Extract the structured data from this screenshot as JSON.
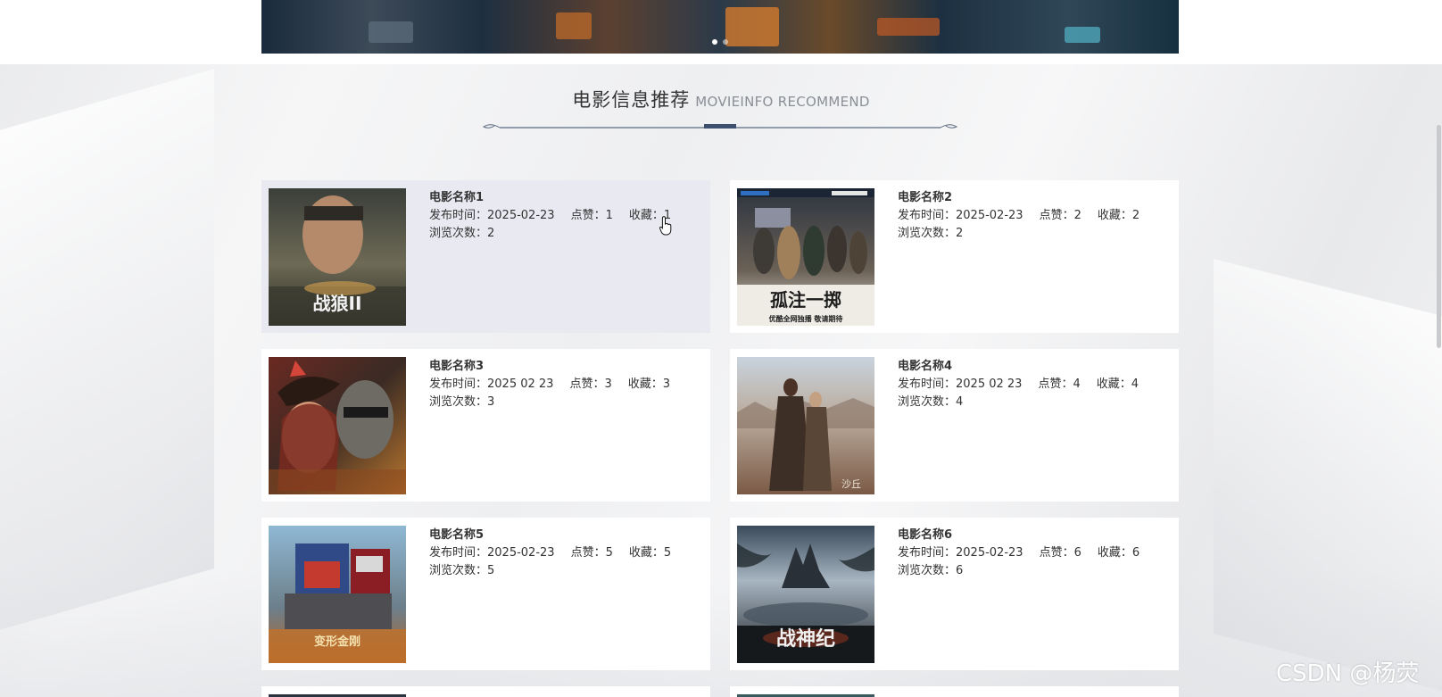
{
  "section": {
    "title": "电影信息推荐",
    "subtitle": "MOVIEINFO RECOMMEND"
  },
  "labels": {
    "release": "发布时间：",
    "likes": "点赞：",
    "favorites": "收藏：",
    "views": "浏览次数："
  },
  "movies": [
    {
      "name": "电影名称1",
      "release_date": "2025-02-23",
      "likes": "1",
      "favorites": "1",
      "views": "2",
      "poster_text": "战狼II"
    },
    {
      "name": "电影名称2",
      "release_date": "2025-02-23",
      "likes": "2",
      "favorites": "2",
      "views": "2",
      "poster_text": "孤注一掷",
      "poster_tagline": "优酷全网独播 敬请期待"
    },
    {
      "name": "电影名称3",
      "release_date": "2025 02 23",
      "likes": "3",
      "favorites": "3",
      "views": "3"
    },
    {
      "name": "电影名称4",
      "release_date": "2025 02 23",
      "likes": "4",
      "favorites": "4",
      "views": "4",
      "poster_text": "沙丘"
    },
    {
      "name": "电影名称5",
      "release_date": "2025-02-23",
      "likes": "5",
      "favorites": "5",
      "views": "5",
      "poster_text": "变形金刚"
    },
    {
      "name": "电影名称6",
      "release_date": "2025-02-23",
      "likes": "6",
      "favorites": "6",
      "views": "6",
      "poster_text": "战神纪"
    }
  ],
  "watermark": "CSDN @杨荧",
  "colors": {
    "accent": "#3d4f6e",
    "card_bg": "#ffffff",
    "card_hover_bg": "#e9eaf1",
    "text": "#333333",
    "subtitle": "#8a8f96"
  },
  "icons": {
    "cursor": "hand-pointer-icon",
    "divider": "ornamental-divider-icon"
  }
}
